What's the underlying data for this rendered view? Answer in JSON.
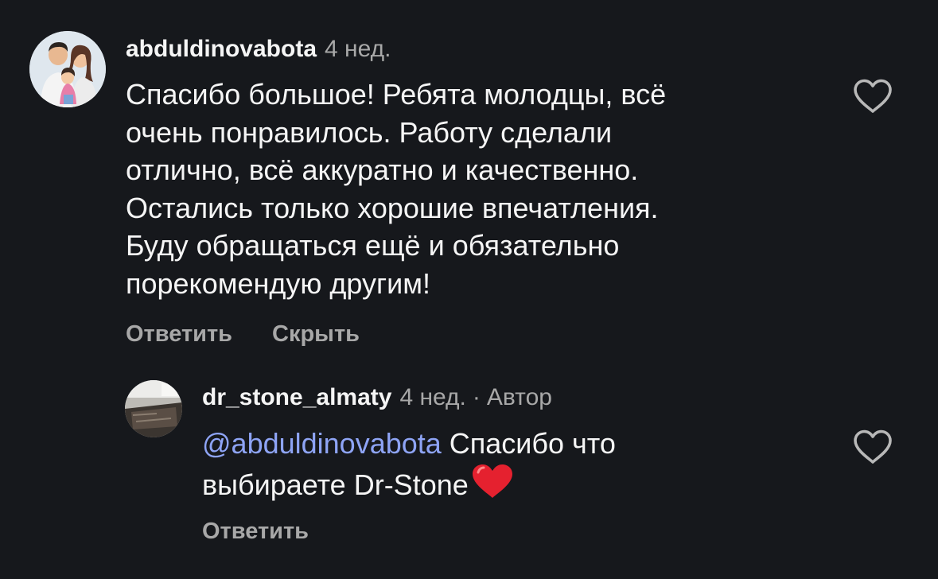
{
  "comment": {
    "username": "abduldinovabota",
    "time": "4 нед.",
    "text_lines": [
      "Спасибо большое! Ребята молодцы, всё",
      "очень понравилось. Работу сделали",
      "отлично, всё аккуратно и качественно.",
      "Остались только хорошие впечатления.",
      "Буду обращаться ещё и обязательно",
      "порекомендую другим!"
    ],
    "reply_label": "Ответить",
    "hide_label": "Скрыть"
  },
  "reply": {
    "username": "dr_stone_almaty",
    "time": "4 нед.",
    "separator": "·",
    "author_label": "Автор",
    "mention": "@abduldinovabota",
    "text_line1": " Спасибо что",
    "text_line2": "выбираете Dr-Stone",
    "reply_label": "Ответить"
  },
  "colors": {
    "background": "#16181c",
    "mention": "#8ea4f5",
    "secondary_text": "#a8a8a8",
    "emoji_heart": "#e5212f"
  },
  "icons": {
    "like": "heart-outline-icon",
    "emoji": "red-heart-emoji"
  }
}
